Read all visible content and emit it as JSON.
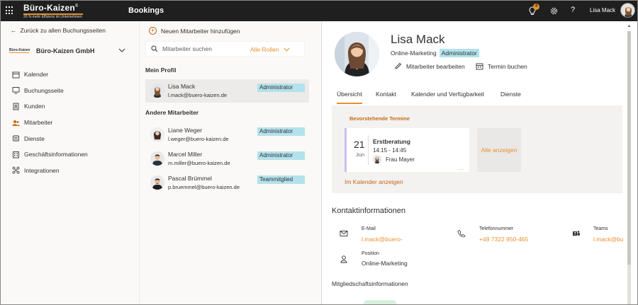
{
  "topbar": {
    "brand_name": "Büro-Kaizen",
    "brand_mark": "®",
    "brand_tagline": "20 % mehr Effizienz im Unternehmen",
    "app_title": "Bookings",
    "notification_count": "4",
    "help_label": "?",
    "user_name": "Lisa Mack"
  },
  "leftnav": {
    "back_label": "Zurück zu allen Buchungsseiten",
    "company_logo_text": "Büro-Kaizen",
    "company_name": "Büro-Kaizen GmbH",
    "items": [
      {
        "label": "Kalender",
        "icon": "calendar-icon"
      },
      {
        "label": "Buchungsseite",
        "icon": "monitor-icon"
      },
      {
        "label": "Kunden",
        "icon": "contact-card-icon"
      },
      {
        "label": "Mitarbeiter",
        "icon": "people-icon",
        "active": true
      },
      {
        "label": "Dienste",
        "icon": "services-icon"
      },
      {
        "label": "Geschäftsinformationen",
        "icon": "building-icon"
      },
      {
        "label": "Integrationen",
        "icon": "integrations-icon"
      }
    ]
  },
  "staff": {
    "add_label": "Neuen Mitarbeiter hinzufügen",
    "search_placeholder": "Mitarbeiter suchen",
    "roles_filter": "Alle Rollen",
    "my_profile_header": "Mein Profil",
    "other_header": "Andere Mitarbeiter",
    "me": {
      "name": "Lisa Mack",
      "email": "l.mack@buero-kaizen.de",
      "role": "Administrator"
    },
    "others": [
      {
        "name": "Liane Weger",
        "email": "l.weger@buero-kaizen.de",
        "role": "Administrator"
      },
      {
        "name": "Marcel Miller",
        "email": "m.miller@buero-kaizen.de",
        "role": "Administrator"
      },
      {
        "name": "Pascal Brümmel",
        "email": "p.bruemmel@buero-kaizen.de",
        "role": "Teammitglied"
      }
    ]
  },
  "profile": {
    "name": "Lisa Mack",
    "department": "Online-Marketing",
    "role": "Administrator",
    "edit_label": "Mitarbeiter bearbeiten",
    "book_label": "Termin buchen",
    "tabs": [
      "Übersicht",
      "Kontakt",
      "Kalender und Verfügbarkeit",
      "Dienste"
    ],
    "active_tab": "Übersicht",
    "upcoming_title": "Bevorstehende Termine",
    "appointment": {
      "day": "21",
      "month": "Jun",
      "title": "Erstberatung",
      "time": "14:15 - 14:45",
      "person": "Frau Mayer",
      "more": "..."
    },
    "show_all_label": "Alle anzeigen",
    "calendar_link": "Im Kalender anzeigen",
    "contact_title": "Kontaktinformationen",
    "email_label": "E-Mail",
    "email_value": "l.mack@buero-",
    "phone_label": "Telefonnummer",
    "phone_value": "+49 7322 950-465",
    "teams_label": "Teams",
    "teams_value": "l.mack@bu",
    "position_label": "Position",
    "position_value": "Online-Marketing",
    "membership_title": "Mitgliedschaftsinformationen"
  },
  "colors": {
    "accent": "#e8912d",
    "topbar": "#1f1f1f",
    "role_badge": "#b3e2ec"
  }
}
